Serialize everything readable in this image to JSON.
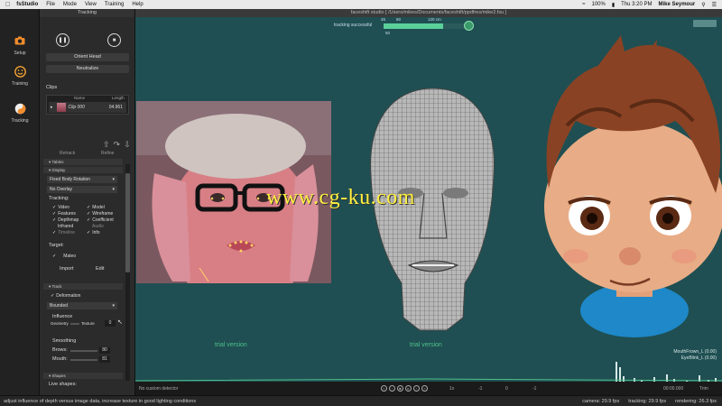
{
  "menubar": {
    "app_name": "fsStudio",
    "menus": [
      "File",
      "Mode",
      "View",
      "Training",
      "Help"
    ],
    "battery": "100%",
    "clock": "Thu 3:20 PM",
    "user": "Mike Seymour"
  },
  "window_title": "faceshift studio [ /Users/mikes/Documents/faceshift/ppdfres/mike2.fsu ]",
  "tools": [
    {
      "label": "Setup",
      "icon": "camera-icon"
    },
    {
      "label": "Training",
      "icon": "smiley-face-icon"
    },
    {
      "label": "Tracking",
      "icon": "yin-yang-icon"
    }
  ],
  "panel": {
    "header": "Tracking",
    "orient_head": "Orient Head",
    "neutralize": "Neutralize",
    "clips_label": "Clips",
    "clips_columns": [
      "Name",
      "Length"
    ],
    "clips": [
      {
        "name": "Clip 000",
        "length": "04.961"
      }
    ],
    "retrack": "Retrack",
    "refine": "Refine",
    "section_tables": "Tables",
    "section_display": "Display",
    "display_dropdown_1": "Fixed Body Rotation",
    "display_dropdown_2": "No Overlay",
    "tracking_label": "Tracking:",
    "checkboxes_left": [
      {
        "label": "Video",
        "checked": true
      },
      {
        "label": "Features",
        "checked": true
      },
      {
        "label": "Depthmap",
        "checked": true
      },
      {
        "label": "Infrared",
        "checked": false
      },
      {
        "label": "Timeline",
        "checked": true
      }
    ],
    "checkboxes_right": [
      {
        "label": "Model",
        "checked": true
      },
      {
        "label": "Wireframe",
        "checked": true
      },
      {
        "label": "Coefficient",
        "checked": true
      },
      {
        "label": "Audio",
        "checked": false
      },
      {
        "label": "Info",
        "checked": true
      }
    ],
    "target_label": "Target:",
    "target_value": "Mateo",
    "import": "Import",
    "edit": "Edit",
    "section_track": "Track",
    "deformation_label": "Deformation",
    "bounded": "Bounded",
    "influence_label": "Influence",
    "geometry_label": "Geometry",
    "texture_label": "Texture",
    "influence_value": "0",
    "smoothing_label": "Smoothing",
    "brows_label": "Brows:",
    "brows_value": "80",
    "mouth_label": "Mouth:",
    "mouth_value": "81",
    "section_shapes": "Shapes",
    "live_shapes": "Live shapes:"
  },
  "viewport": {
    "tracking_status": "tracking successful",
    "meter_ticks": [
      "45",
      "60",
      "120 cm"
    ],
    "meter_value": "50",
    "watermark": "www.cg-ku.com",
    "trial_left": "trial version",
    "trial_center": "trial version",
    "blendshapes": [
      "MouthFrown_L (0.00)",
      "EyeBlink_L (0.00)"
    ]
  },
  "timeline": {
    "detector": "No custom detector",
    "zoom": "1x",
    "field_1": "-1",
    "field_2": "0",
    "field_3": "-1",
    "time": "00:00.000",
    "trim": "Trim"
  },
  "statusbar": {
    "hint": "adjust influence of depth versus image data, increase texture in good lighting conditions",
    "camera": "camera: 29.9 fps",
    "tracking": "tracking: 29.9 fps",
    "rendering": "rendering: 26.3 fps"
  },
  "colors": {
    "viewport_bg": "#1f4f52",
    "trial_text": "#4fc08a",
    "watermark": "#ffef40",
    "meter_fill": "#5ad09a"
  }
}
